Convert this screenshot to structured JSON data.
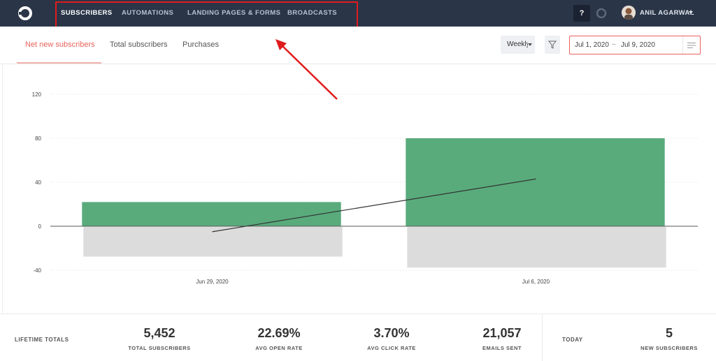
{
  "nav": {
    "items": [
      {
        "label": "SUBSCRIBERS",
        "active": true
      },
      {
        "label": "AUTOMATIONS",
        "active": false
      },
      {
        "label": "LANDING PAGES & FORMS",
        "active": false
      },
      {
        "label": "BROADCASTS",
        "active": false
      }
    ],
    "help_label": "?",
    "user_name": "ANIL AGARWAL"
  },
  "tabs": [
    {
      "label": "Net new subscribers",
      "active": true
    },
    {
      "label": "Total subscribers",
      "active": false
    },
    {
      "label": "Purchases",
      "active": false
    }
  ],
  "controls": {
    "interval_value": "Weekly",
    "date_start": "Jul 1, 2020",
    "date_separator": "–",
    "date_end": "Jul 9, 2020"
  },
  "chart_data": {
    "type": "bar",
    "categories": [
      "Jun 29, 2020",
      "Jul 6, 2020"
    ],
    "series": [
      {
        "values": [
          22,
          80
        ],
        "color": "#59ab7c"
      },
      {
        "values": [
          -27,
          -37
        ],
        "color": "#dcdcdc"
      }
    ],
    "trend_line": {
      "values": [
        -5,
        43
      ],
      "color": "#333333"
    },
    "yticks": [
      120,
      80,
      40,
      0,
      -40
    ],
    "ylim": [
      -40,
      120
    ],
    "grid": true
  },
  "totals": {
    "lifetime_label": "LIFETIME TOTALS",
    "metrics": [
      {
        "value": "5,452",
        "label": "TOTAL SUBSCRIBERS"
      },
      {
        "value": "22.69%",
        "label": "AVG OPEN RATE"
      },
      {
        "value": "3.70%",
        "label": "AVG CLICK RATE"
      },
      {
        "value": "21,057",
        "label": "EMAILS SENT"
      }
    ],
    "today_label": "TODAY",
    "today_metric": {
      "value": "5",
      "label": "NEW SUBSCRIBERS"
    }
  },
  "colors": {
    "nav_bg": "#2a3548",
    "accent": "#e8625a",
    "annotation": "#e01b1b"
  }
}
